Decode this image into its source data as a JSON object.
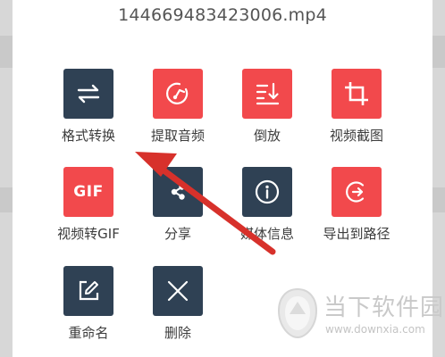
{
  "dialog": {
    "title": "144669483423006.mp4"
  },
  "actions": [
    {
      "label": "格式转换",
      "icon": "swap-arrows-icon",
      "color": "#2f4154"
    },
    {
      "label": "提取音频",
      "icon": "audio-extract-icon",
      "color": "#f2494c"
    },
    {
      "label": "倒放",
      "icon": "reverse-sort-icon",
      "color": "#f2494c"
    },
    {
      "label": "视频截图",
      "icon": "crop-icon",
      "color": "#f2494c"
    },
    {
      "label": "视频转GIF",
      "icon": "gif-icon",
      "icon_text": "GIF",
      "color": "#f2494c"
    },
    {
      "label": "分享",
      "icon": "share-icon",
      "color": "#2f4154"
    },
    {
      "label": "媒体信息",
      "icon": "info-icon",
      "color": "#2f4154"
    },
    {
      "label": "导出到路径",
      "icon": "export-icon",
      "color": "#f2494c"
    },
    {
      "label": "重命名",
      "icon": "edit-icon",
      "color": "#2f4154"
    },
    {
      "label": "删除",
      "icon": "close-icon",
      "color": "#2f4154"
    }
  ],
  "annotation": {
    "arrow_color": "#d7312b"
  },
  "watermark": {
    "cn": "当下软件园",
    "en": "www.downxia.com"
  }
}
